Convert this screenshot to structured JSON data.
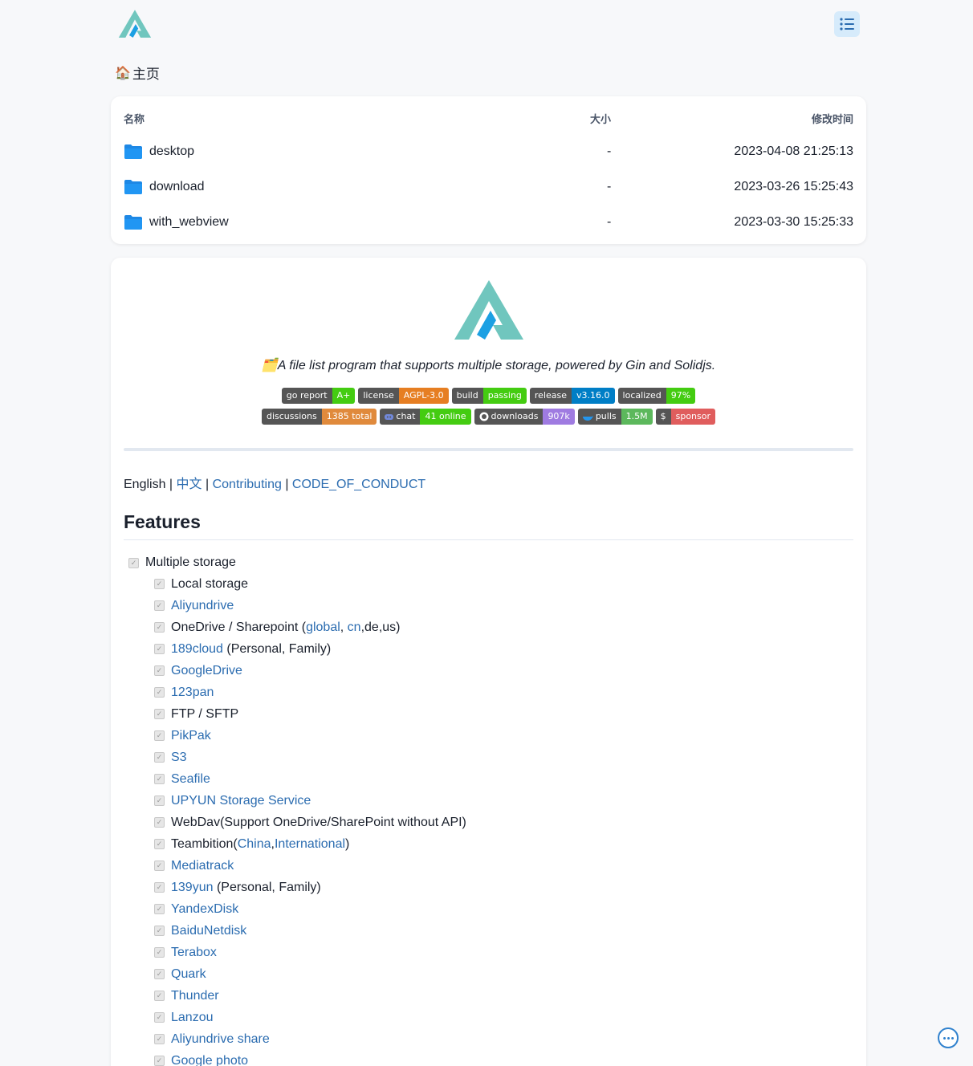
{
  "header": {
    "logo_icon": "alist-logo-icon",
    "menu_icon": "list-icon"
  },
  "breadcrumb": {
    "home_icon": "🏠",
    "label": "主页"
  },
  "files": {
    "columns": {
      "name": "名称",
      "size": "大小",
      "modified": "修改时间"
    },
    "rows": [
      {
        "name": "desktop",
        "size": "-",
        "modified": "2023-04-08 21:25:13"
      },
      {
        "name": "download",
        "size": "-",
        "modified": "2023-03-26 15:25:43"
      },
      {
        "name": "with_webview",
        "size": "-",
        "modified": "2023-03-30 15:25:33"
      }
    ]
  },
  "readme": {
    "tagline_icon": "🗂️",
    "tagline": "A file list program that supports multiple storage, powered by Gin and Solidjs.",
    "badges_row1": [
      {
        "label": "go report",
        "value": "A+",
        "color": "#4c1"
      },
      {
        "label": "license",
        "value": "AGPL-3.0",
        "color": "#e67e22"
      },
      {
        "label": "build",
        "value": "passing",
        "color": "#4c1"
      },
      {
        "label": "release",
        "value": "v3.16.0",
        "color": "#007ec6"
      },
      {
        "label": "localized",
        "value": "97%",
        "color": "#4c1"
      }
    ],
    "badges_row2": [
      {
        "label": "discussions",
        "value": "1385 total",
        "color": "#e08a3c"
      },
      {
        "label": "chat",
        "value": "41 online",
        "color": "#4c1",
        "icon": "discord-icon"
      },
      {
        "label": "downloads",
        "value": "907k",
        "color": "#9f7be1",
        "icon": "github-icon"
      },
      {
        "label": "pulls",
        "value": "1.5M",
        "color": "#5cb85c",
        "icon": "docker-icon"
      },
      {
        "label": "$",
        "value": "sponsor",
        "color": "#e05d5d"
      }
    ],
    "langs": {
      "english": "English",
      "sep": " | ",
      "chinese": "中文",
      "contributing": "Contributing",
      "coc": "CODE_OF_CONDUCT"
    },
    "features_title": "Features",
    "top_feature": "Multiple storage",
    "storages": [
      {
        "parts": [
          {
            "t": "Local storage"
          }
        ]
      },
      {
        "parts": [
          {
            "t": "Aliyundrive",
            "link": true
          }
        ]
      },
      {
        "parts": [
          {
            "t": "OneDrive / Sharepoint ("
          },
          {
            "t": "global",
            "link": true
          },
          {
            "t": ", "
          },
          {
            "t": "cn",
            "link": true
          },
          {
            "t": ",de,us)"
          }
        ]
      },
      {
        "parts": [
          {
            "t": "189cloud",
            "link": true
          },
          {
            "t": " (Personal, Family)"
          }
        ]
      },
      {
        "parts": [
          {
            "t": "GoogleDrive",
            "link": true
          }
        ]
      },
      {
        "parts": [
          {
            "t": "123pan",
            "link": true
          }
        ]
      },
      {
        "parts": [
          {
            "t": "FTP / SFTP"
          }
        ]
      },
      {
        "parts": [
          {
            "t": "PikPak",
            "link": true
          }
        ]
      },
      {
        "parts": [
          {
            "t": "S3",
            "link": true
          }
        ]
      },
      {
        "parts": [
          {
            "t": "Seafile",
            "link": true
          }
        ]
      },
      {
        "parts": [
          {
            "t": "UPYUN Storage Service",
            "link": true
          }
        ]
      },
      {
        "parts": [
          {
            "t": "WebDav(Support OneDrive/SharePoint without API)"
          }
        ]
      },
      {
        "parts": [
          {
            "t": "Teambition("
          },
          {
            "t": "China",
            "link": true
          },
          {
            "t": ","
          },
          {
            "t": "International",
            "link": true
          },
          {
            "t": ")"
          }
        ]
      },
      {
        "parts": [
          {
            "t": "Mediatrack",
            "link": true
          }
        ]
      },
      {
        "parts": [
          {
            "t": "139yun",
            "link": true
          },
          {
            "t": " (Personal, Family)"
          }
        ]
      },
      {
        "parts": [
          {
            "t": "YandexDisk",
            "link": true
          }
        ]
      },
      {
        "parts": [
          {
            "t": "BaiduNetdisk",
            "link": true
          }
        ]
      },
      {
        "parts": [
          {
            "t": "Terabox",
            "link": true
          }
        ]
      },
      {
        "parts": [
          {
            "t": "Quark",
            "link": true
          }
        ]
      },
      {
        "parts": [
          {
            "t": "Thunder",
            "link": true
          }
        ]
      },
      {
        "parts": [
          {
            "t": "Lanzou",
            "link": true
          }
        ]
      },
      {
        "parts": [
          {
            "t": "Aliyundrive share",
            "link": true
          }
        ]
      },
      {
        "parts": [
          {
            "t": "Google photo",
            "link": true
          }
        ]
      }
    ]
  },
  "chat_button_icon": "more-horizontal-icon",
  "colors": {
    "accent": "#2b6cb0",
    "folder": "#1e88e5",
    "logo_teal": "#70c6be",
    "logo_blue": "#1ca0e3"
  }
}
